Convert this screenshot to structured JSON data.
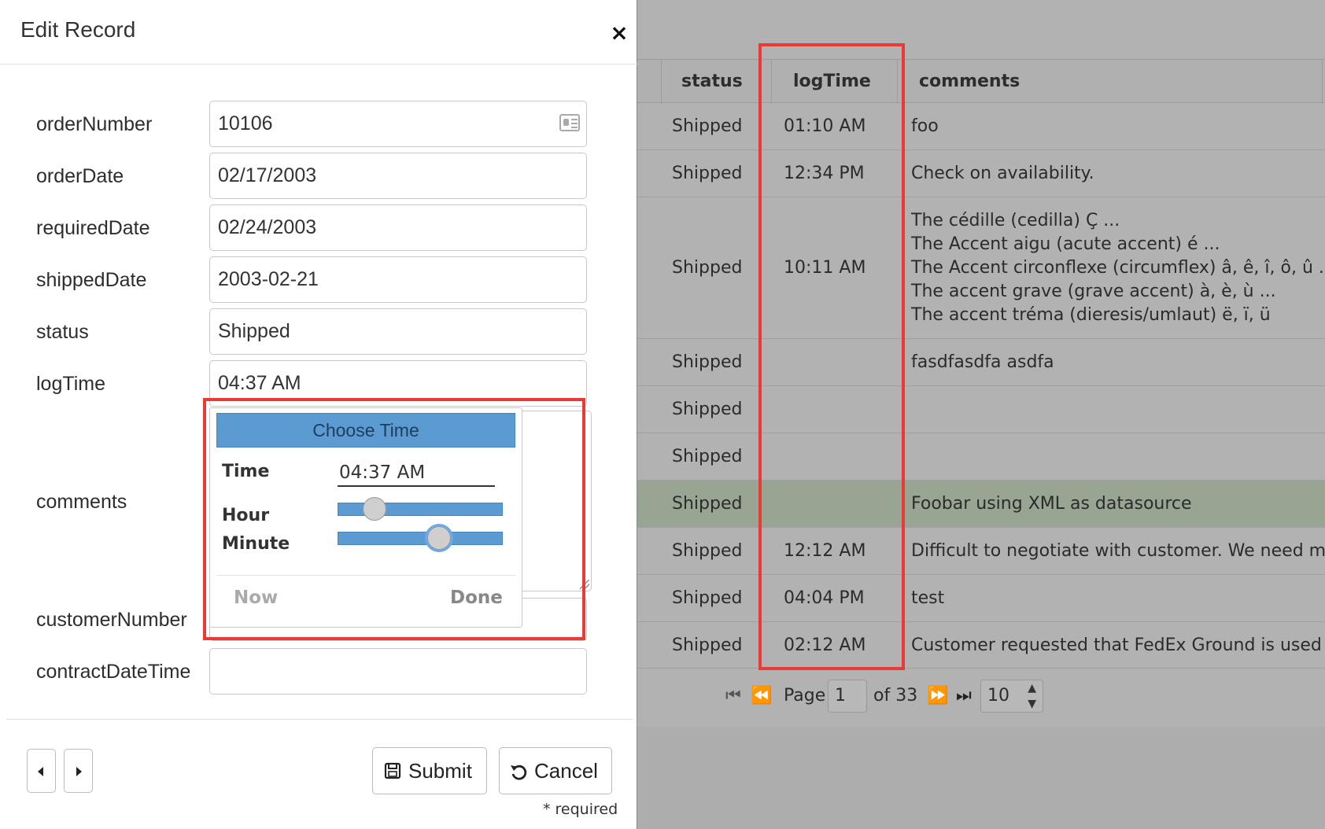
{
  "modal": {
    "title": "Edit Record",
    "close_label": "×"
  },
  "fields": {
    "orderNumber": {
      "label": "orderNumber",
      "value": "10106"
    },
    "orderDate": {
      "label": "orderDate",
      "value": "02/17/2003"
    },
    "requiredDate": {
      "label": "requiredDate",
      "value": "02/24/2003"
    },
    "shippedDate": {
      "label": "shippedDate",
      "value": "2003-02-21"
    },
    "status": {
      "label": "status",
      "value": "Shipped"
    },
    "logTime": {
      "label": "logTime",
      "value": "04:37 AM"
    },
    "comments": {
      "label": "comments",
      "value": ""
    },
    "customerNumber": {
      "label": "customerNumber",
      "value": ""
    },
    "contractDateTime": {
      "label": "contractDateTime",
      "value": ""
    }
  },
  "timepicker": {
    "header": "Choose Time",
    "time_label": "Time",
    "time_value": "04:37 AM",
    "hour_label": "Hour",
    "minute_label": "Minute",
    "hour_level": 0.17,
    "minute_level": 0.63,
    "now_label": "Now",
    "done_label": "Done"
  },
  "footer": {
    "submit_label": "Submit",
    "cancel_label": "Cancel",
    "required_note": "* required"
  },
  "grid": {
    "columns": {
      "status": "status",
      "logTime": "logTime",
      "comments": "comments"
    },
    "rows": [
      {
        "status": "Shipped",
        "logTime": "01:10 AM",
        "comments": [
          "foo"
        ]
      },
      {
        "status": "Shipped",
        "logTime": "12:34 PM",
        "comments": [
          "Check on availability."
        ]
      },
      {
        "status": "Shipped",
        "logTime": "10:11 AM",
        "comments": [
          "The cédille (cedilla) Ç ...",
          "The Accent aigu (acute accent) é ...",
          "The Accent circonflexe (circumflex) â, ê, î, ô, û ...",
          "The accent grave (grave accent) à, è, ù ...",
          "The accent tréma (dieresis/umlaut) ë, ï, ü"
        ]
      },
      {
        "status": "Shipped",
        "logTime": "",
        "comments": [
          "fasdfasdfa asdfa"
        ]
      },
      {
        "status": "Shipped",
        "logTime": "",
        "comments": [
          ""
        ]
      },
      {
        "status": "Shipped",
        "logTime": "",
        "comments": [
          ""
        ]
      },
      {
        "status": "Shipped",
        "logTime": "",
        "comments": [
          "Foobar using XML as datasource"
        ]
      },
      {
        "status": "Shipped",
        "logTime": "12:12 AM",
        "comments": [
          "Difficult to negotiate with customer. We need more m"
        ]
      },
      {
        "status": "Shipped",
        "logTime": "04:04 PM",
        "comments": [
          "test"
        ]
      },
      {
        "status": "Shipped",
        "logTime": "02:12 AM",
        "comments": [
          "Customer requested that FedEx Ground is used for t"
        ]
      }
    ],
    "selected_row": 6
  },
  "pager": {
    "page_label": "Page",
    "page_value": "1",
    "of_label": "of 33",
    "page_size": "10"
  },
  "colors": {
    "accent": "#5b9bd1",
    "highlight_box": "#ea3a34",
    "selected_row": "#97a592"
  }
}
